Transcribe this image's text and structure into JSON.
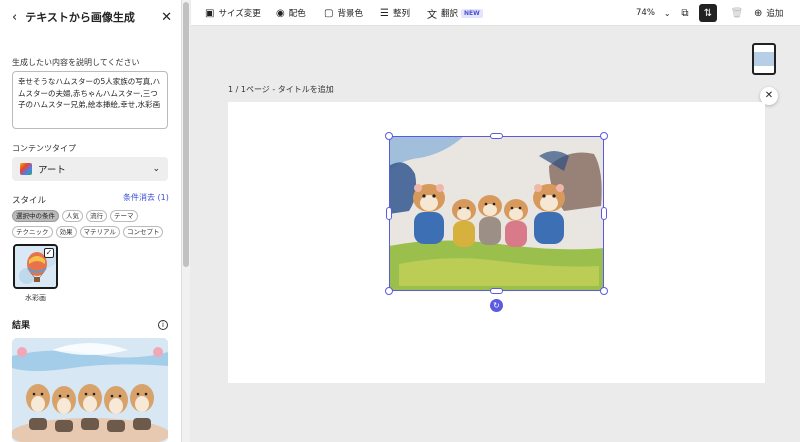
{
  "panel": {
    "title": "テキストから画像生成",
    "prompt_label": "生成したい内容を説明してください",
    "prompt_text": "幸せそうなハムスターの5人家族の写真,ハムスターの夫婦,赤ちゃんハムスター,三つ子のハムスター兄弟,絵本挿絵,幸せ,水彩画",
    "content_type_label": "コンテンツタイプ",
    "content_type_value": "アート",
    "style_label": "スタイル",
    "clear_filters": "条件消去 (1)",
    "chips": [
      "選択中の条件",
      "人気",
      "流行",
      "テーマ",
      "テクニック",
      "効果",
      "マテリアル",
      "コンセプト"
    ],
    "selected_style": "水彩画",
    "result_label": "結果"
  },
  "toolbar": {
    "resize": "サイズ変更",
    "color": "配色",
    "bg_color": "背景色",
    "align": "整列",
    "translate": "翻訳",
    "new_badge": "NEW",
    "zoom": "74%",
    "add": "追加"
  },
  "canvas": {
    "page_label": "1 / 1ページ - タイトルを追加"
  }
}
